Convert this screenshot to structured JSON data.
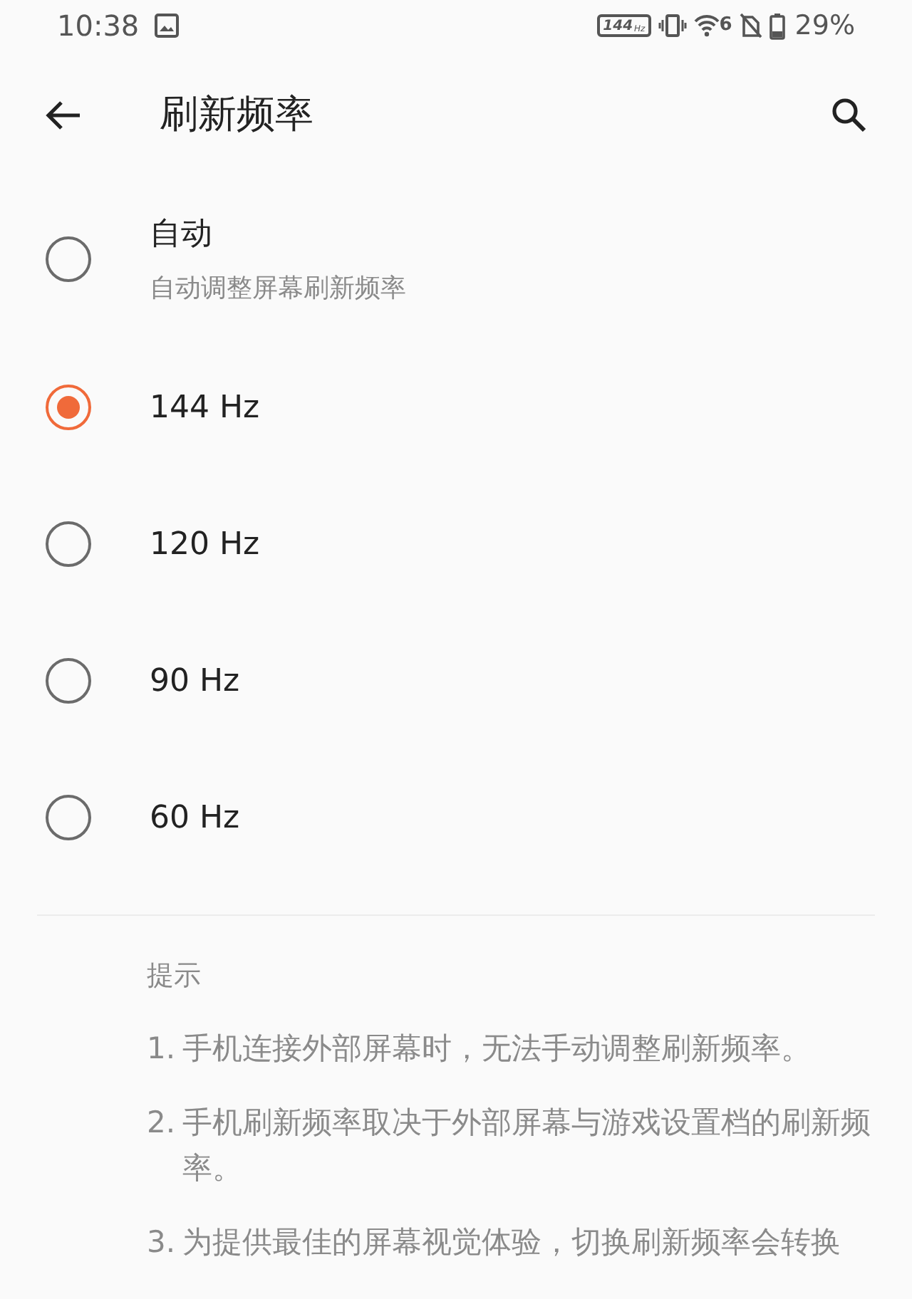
{
  "status_bar": {
    "time": "10:38",
    "refresh_badge": {
      "value": "144",
      "unit": "Hz"
    },
    "wifi_generation": "6",
    "battery": "29%"
  },
  "title": "刷新频率",
  "options": [
    {
      "label": "自动",
      "description": "自动调整屏幕刷新频率",
      "selected": false
    },
    {
      "label": "144 Hz",
      "selected": true
    },
    {
      "label": "120 Hz",
      "selected": false
    },
    {
      "label": "90 Hz",
      "selected": false
    },
    {
      "label": "60 Hz",
      "selected": false
    }
  ],
  "tips": {
    "title": "提示",
    "items": [
      {
        "number": "1.",
        "text": "手机连接外部屏幕时，无法手动调整刷新频率。"
      },
      {
        "number": "2.",
        "text": "手机刷新频率取决于外部屏幕与游戏设置档的刷新频率。"
      },
      {
        "number": "3.",
        "text": "为提供最佳的屏幕视觉体验，切换刷新频率会转换"
      }
    ]
  }
}
